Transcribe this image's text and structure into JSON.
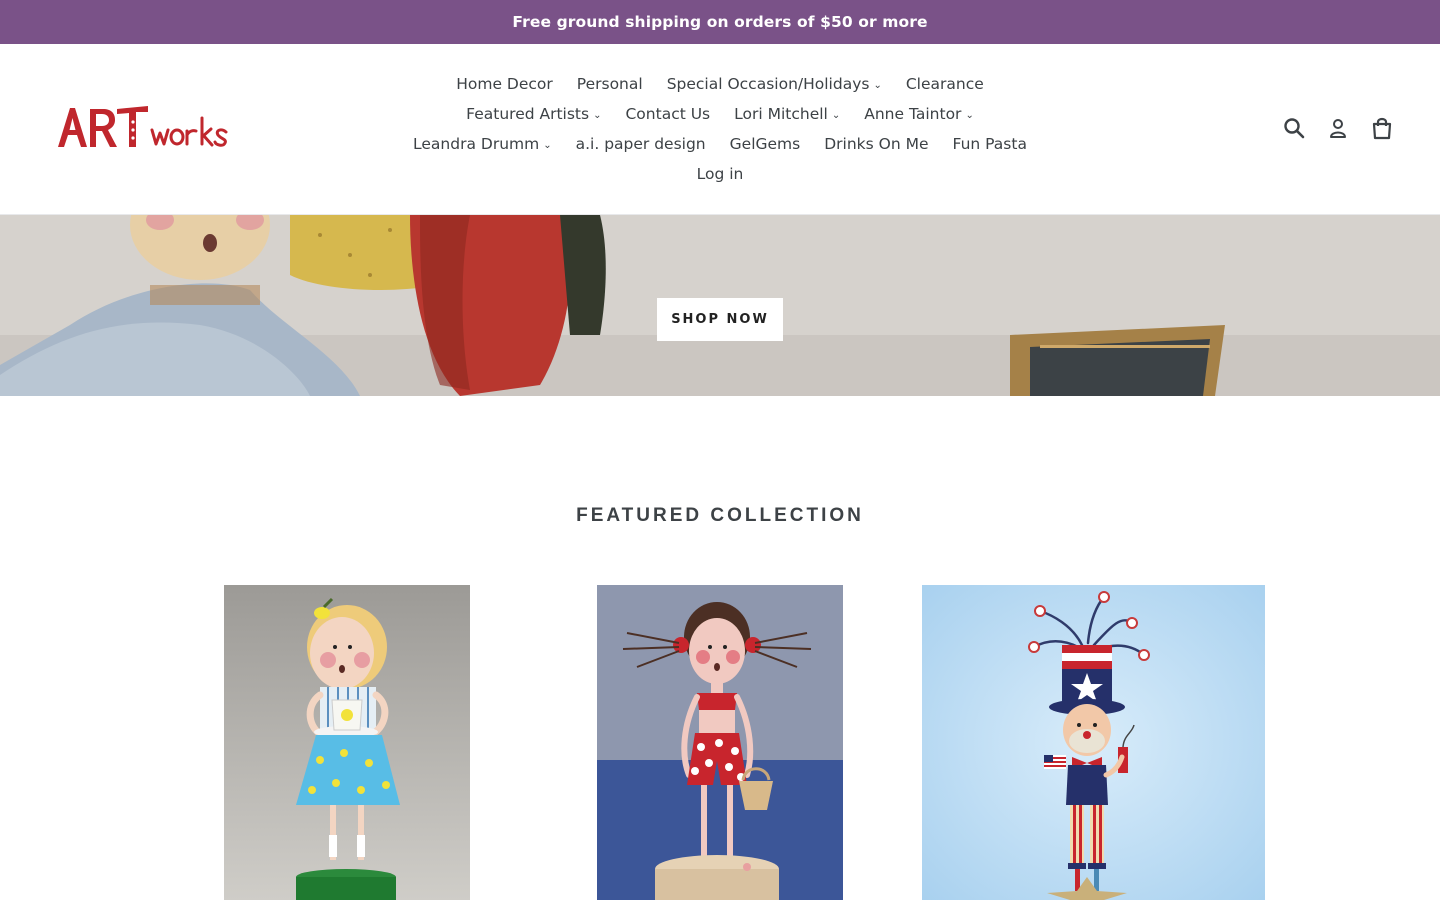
{
  "announcement": {
    "text": "Free ground shipping on orders of $50 or more"
  },
  "header": {
    "logo_text": "ARTworks",
    "nav_rows": [
      [
        {
          "label": "Home Decor",
          "has_dropdown": false
        },
        {
          "label": "Personal",
          "has_dropdown": false
        },
        {
          "label": "Special Occasion/Holidays",
          "has_dropdown": true
        },
        {
          "label": "Clearance",
          "has_dropdown": false
        }
      ],
      [
        {
          "label": "Featured Artists",
          "has_dropdown": true
        },
        {
          "label": "Contact Us",
          "has_dropdown": false
        },
        {
          "label": "Lori Mitchell",
          "has_dropdown": true
        },
        {
          "label": "Anne Taintor",
          "has_dropdown": true
        }
      ],
      [
        {
          "label": "Leandra Drumm",
          "has_dropdown": true
        },
        {
          "label": "a.i. paper design",
          "has_dropdown": false
        },
        {
          "label": "GelGems",
          "has_dropdown": false
        },
        {
          "label": "Drinks On Me",
          "has_dropdown": false
        },
        {
          "label": "Fun Pasta",
          "has_dropdown": false
        }
      ],
      [
        {
          "label": "Log in",
          "has_dropdown": false
        }
      ]
    ],
    "icons": [
      "search-icon",
      "account-icon",
      "cart-icon"
    ]
  },
  "hero": {
    "button_label": "SHOP NOW"
  },
  "featured": {
    "title": "FEATURED COLLECTION"
  },
  "colors": {
    "announcement_bg": "#7a5288",
    "logo_red": "#c0272d",
    "text": "#3d4246"
  }
}
